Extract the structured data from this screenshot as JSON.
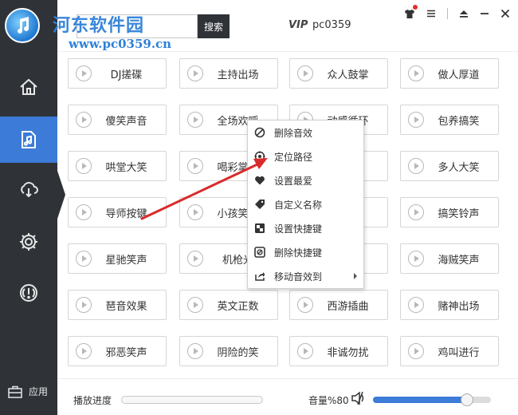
{
  "watermark": {
    "site_name": "河东软件园",
    "url": "www.pc0359.cn"
  },
  "search": {
    "placeholder": "",
    "button_label": "搜索"
  },
  "user": {
    "vip_label": "VIP",
    "name": "pc0359"
  },
  "sidebar": {
    "items": [
      {
        "name": "home",
        "icon": "home-icon",
        "active": false
      },
      {
        "name": "sound-effects",
        "icon": "music-file-icon",
        "active": true
      },
      {
        "name": "cloud",
        "icon": "cloud-download-icon",
        "active": false
      },
      {
        "name": "settings",
        "icon": "gear-icon",
        "active": false
      },
      {
        "name": "about",
        "icon": "alert-icon",
        "active": false
      }
    ],
    "apps_label": "应用"
  },
  "sound_buttons": [
    "DJ搓碟",
    "主持出场",
    "众人鼓掌",
    "做人厚道",
    "傻笑声音",
    "全场欢呼",
    "动感循环",
    "包养搞笑",
    "哄堂大笑",
    "喝彩掌声",
    "",
    "多人大笑",
    "导师按键",
    "小孩笑声",
    "",
    "搞笑铃声",
    "星驰笑声",
    "机枪光",
    "",
    "海贼笑声",
    "琶音效果",
    "英文正数",
    "西游插曲",
    "赌神出场",
    "邪恶笑声",
    "阴险的笑",
    "非诚勿扰",
    "鸡叫进行"
  ],
  "context_menu": {
    "items": [
      {
        "label": "删除音效",
        "icon": "forbidden-icon"
      },
      {
        "label": "定位路径",
        "icon": "locate-icon"
      },
      {
        "label": "设置最爱",
        "icon": "heart-icon"
      },
      {
        "label": "自定义名称",
        "icon": "tag-icon"
      },
      {
        "label": "设置快捷键",
        "icon": "shortcut-icon"
      },
      {
        "label": "删除快捷键",
        "icon": "delete-shortcut-icon"
      },
      {
        "label": "移动音效到",
        "icon": "move-icon",
        "has_submenu": true
      }
    ]
  },
  "bottom_bar": {
    "progress_label": "播放进度",
    "progress_value": 0,
    "volume_label": "音量%80",
    "volume_value": 80
  },
  "colors": {
    "sidebar": "#2f3338",
    "accent": "#3c7bd8",
    "annotation_arrow": "#d92b2b"
  }
}
